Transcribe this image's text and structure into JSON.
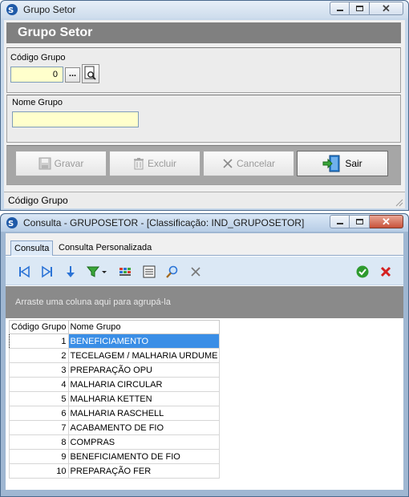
{
  "window1": {
    "title": "Grupo Setor",
    "header": "Grupo Setor",
    "codigo_label": "Código Grupo",
    "codigo_value": "0",
    "browse_label": "...",
    "nome_label": "Nome Grupo",
    "nome_value": "",
    "buttons": {
      "gravar": "Gravar",
      "excluir": "Excluir",
      "cancelar": "Cancelar",
      "sair": "Sair"
    },
    "status": "Código Grupo"
  },
  "window2": {
    "title": "Consulta - GRUPOSETOR - [Classificação: IND_GRUPOSETOR]",
    "tabs": [
      "Consulta",
      "Consulta Personalizada"
    ],
    "groupby_hint": "Arraste uma coluna aqui para agrupá-la",
    "columns": [
      "Código Grupo",
      "Nome Grupo"
    ],
    "rows": [
      {
        "code": "1",
        "name": "BENEFICIAMENTO"
      },
      {
        "code": "2",
        "name": "TECELAGEM / MALHARIA URDUME"
      },
      {
        "code": "3",
        "name": "PREPARAÇÃO OPU"
      },
      {
        "code": "4",
        "name": "MALHARIA CIRCULAR"
      },
      {
        "code": "5",
        "name": "MALHARIA KETTEN"
      },
      {
        "code": "6",
        "name": "MALHARIA RASCHELL"
      },
      {
        "code": "7",
        "name": "ACABAMENTO DE FIO"
      },
      {
        "code": "8",
        "name": "COMPRAS"
      },
      {
        "code": "9",
        "name": "BENEFICIAMENTO DE FIO"
      },
      {
        "code": "10",
        "name": "PREPARAÇÃO FER"
      }
    ],
    "selected_row": 0
  },
  "colors": {
    "header_bar": "#808080",
    "input_bg": "#ffffcc",
    "selection": "#3a8ee6",
    "confirm": "#2e9a2e",
    "cancel": "#d42020",
    "nav_blue": "#2b73d6"
  }
}
